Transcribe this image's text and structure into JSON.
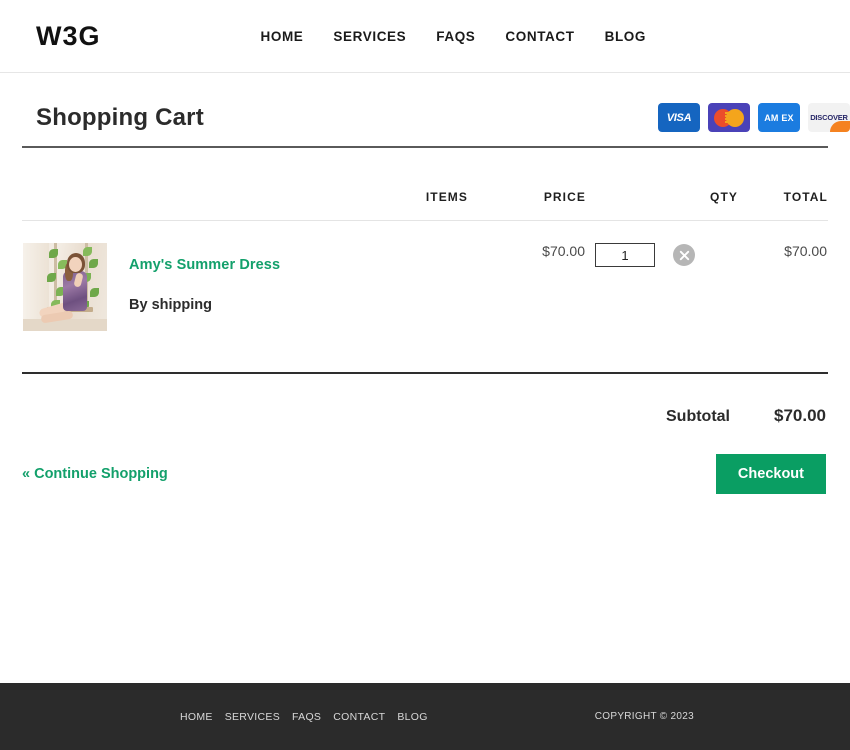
{
  "header": {
    "brand": "W3G",
    "nav": [
      {
        "label": "HOME"
      },
      {
        "label": "SERVICES"
      },
      {
        "label": "FAQS"
      },
      {
        "label": "CONTACT"
      },
      {
        "label": "BLOG"
      }
    ]
  },
  "page": {
    "title": "Shopping Cart"
  },
  "payment_methods": [
    {
      "name": "visa",
      "label": "VISA"
    },
    {
      "name": "mastercard",
      "label": ""
    },
    {
      "name": "amex",
      "label": "AM EX"
    },
    {
      "name": "discover",
      "label": "DISCOVER"
    }
  ],
  "cart": {
    "columns": {
      "items": "ITEMS",
      "price": "PRICE",
      "qty": "QTY",
      "total": "TOTAL"
    },
    "rows": [
      {
        "name": "Amy's Summer Dress",
        "subtext": "By shipping",
        "price": "$70.00",
        "qty": "1",
        "total": "$70.00",
        "remove_icon": "close-circle-icon"
      }
    ]
  },
  "summary": {
    "subtotal_label": "Subtotal",
    "subtotal_value": "$70.00"
  },
  "actions": {
    "continue_label": "« Continue Shopping",
    "checkout_label": "Checkout"
  },
  "footer": {
    "nav": [
      {
        "label": "HOME"
      },
      {
        "label": "SERVICES"
      },
      {
        "label": "FAQS"
      },
      {
        "label": "CONTACT"
      },
      {
        "label": "BLOG"
      }
    ],
    "copyright": "COPYRIGHT © 2023"
  },
  "colors": {
    "brand_green": "#0a9e63",
    "link_green": "#13a06b",
    "footer_bg": "#2b2b2b"
  }
}
